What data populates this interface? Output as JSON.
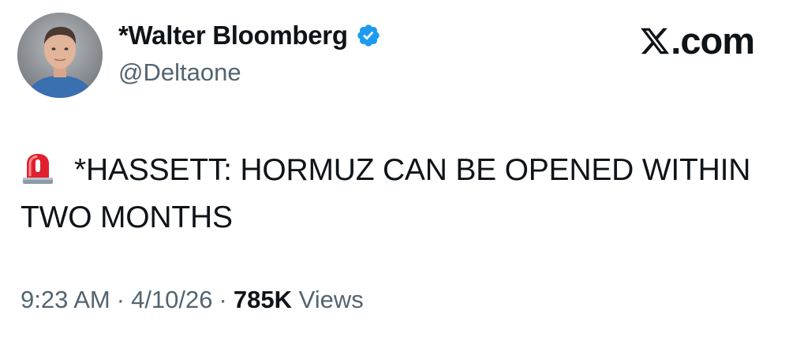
{
  "author": {
    "display_name": "*Walter Bloomberg",
    "handle": "@Deltaone",
    "verified": true,
    "verified_icon": "verified-badge-icon",
    "avatar_icon": "avatar"
  },
  "brand": {
    "logo_icon": "x-logo-icon",
    "domain_suffix": ".com"
  },
  "tweet": {
    "emoji_icon": "siren-icon",
    "text": "*HASSETT: HORMUZ CAN BE OPENED WITHIN TWO MONTHS"
  },
  "meta": {
    "time": "9:23 AM",
    "separator": "·",
    "date": "4/10/26",
    "views_count": "785K",
    "views_label": "Views"
  },
  "colors": {
    "primary_text": "#0f1419",
    "secondary_text": "#536471",
    "verified_blue": "#1d9bf0",
    "siren_red": "#e0202e"
  }
}
